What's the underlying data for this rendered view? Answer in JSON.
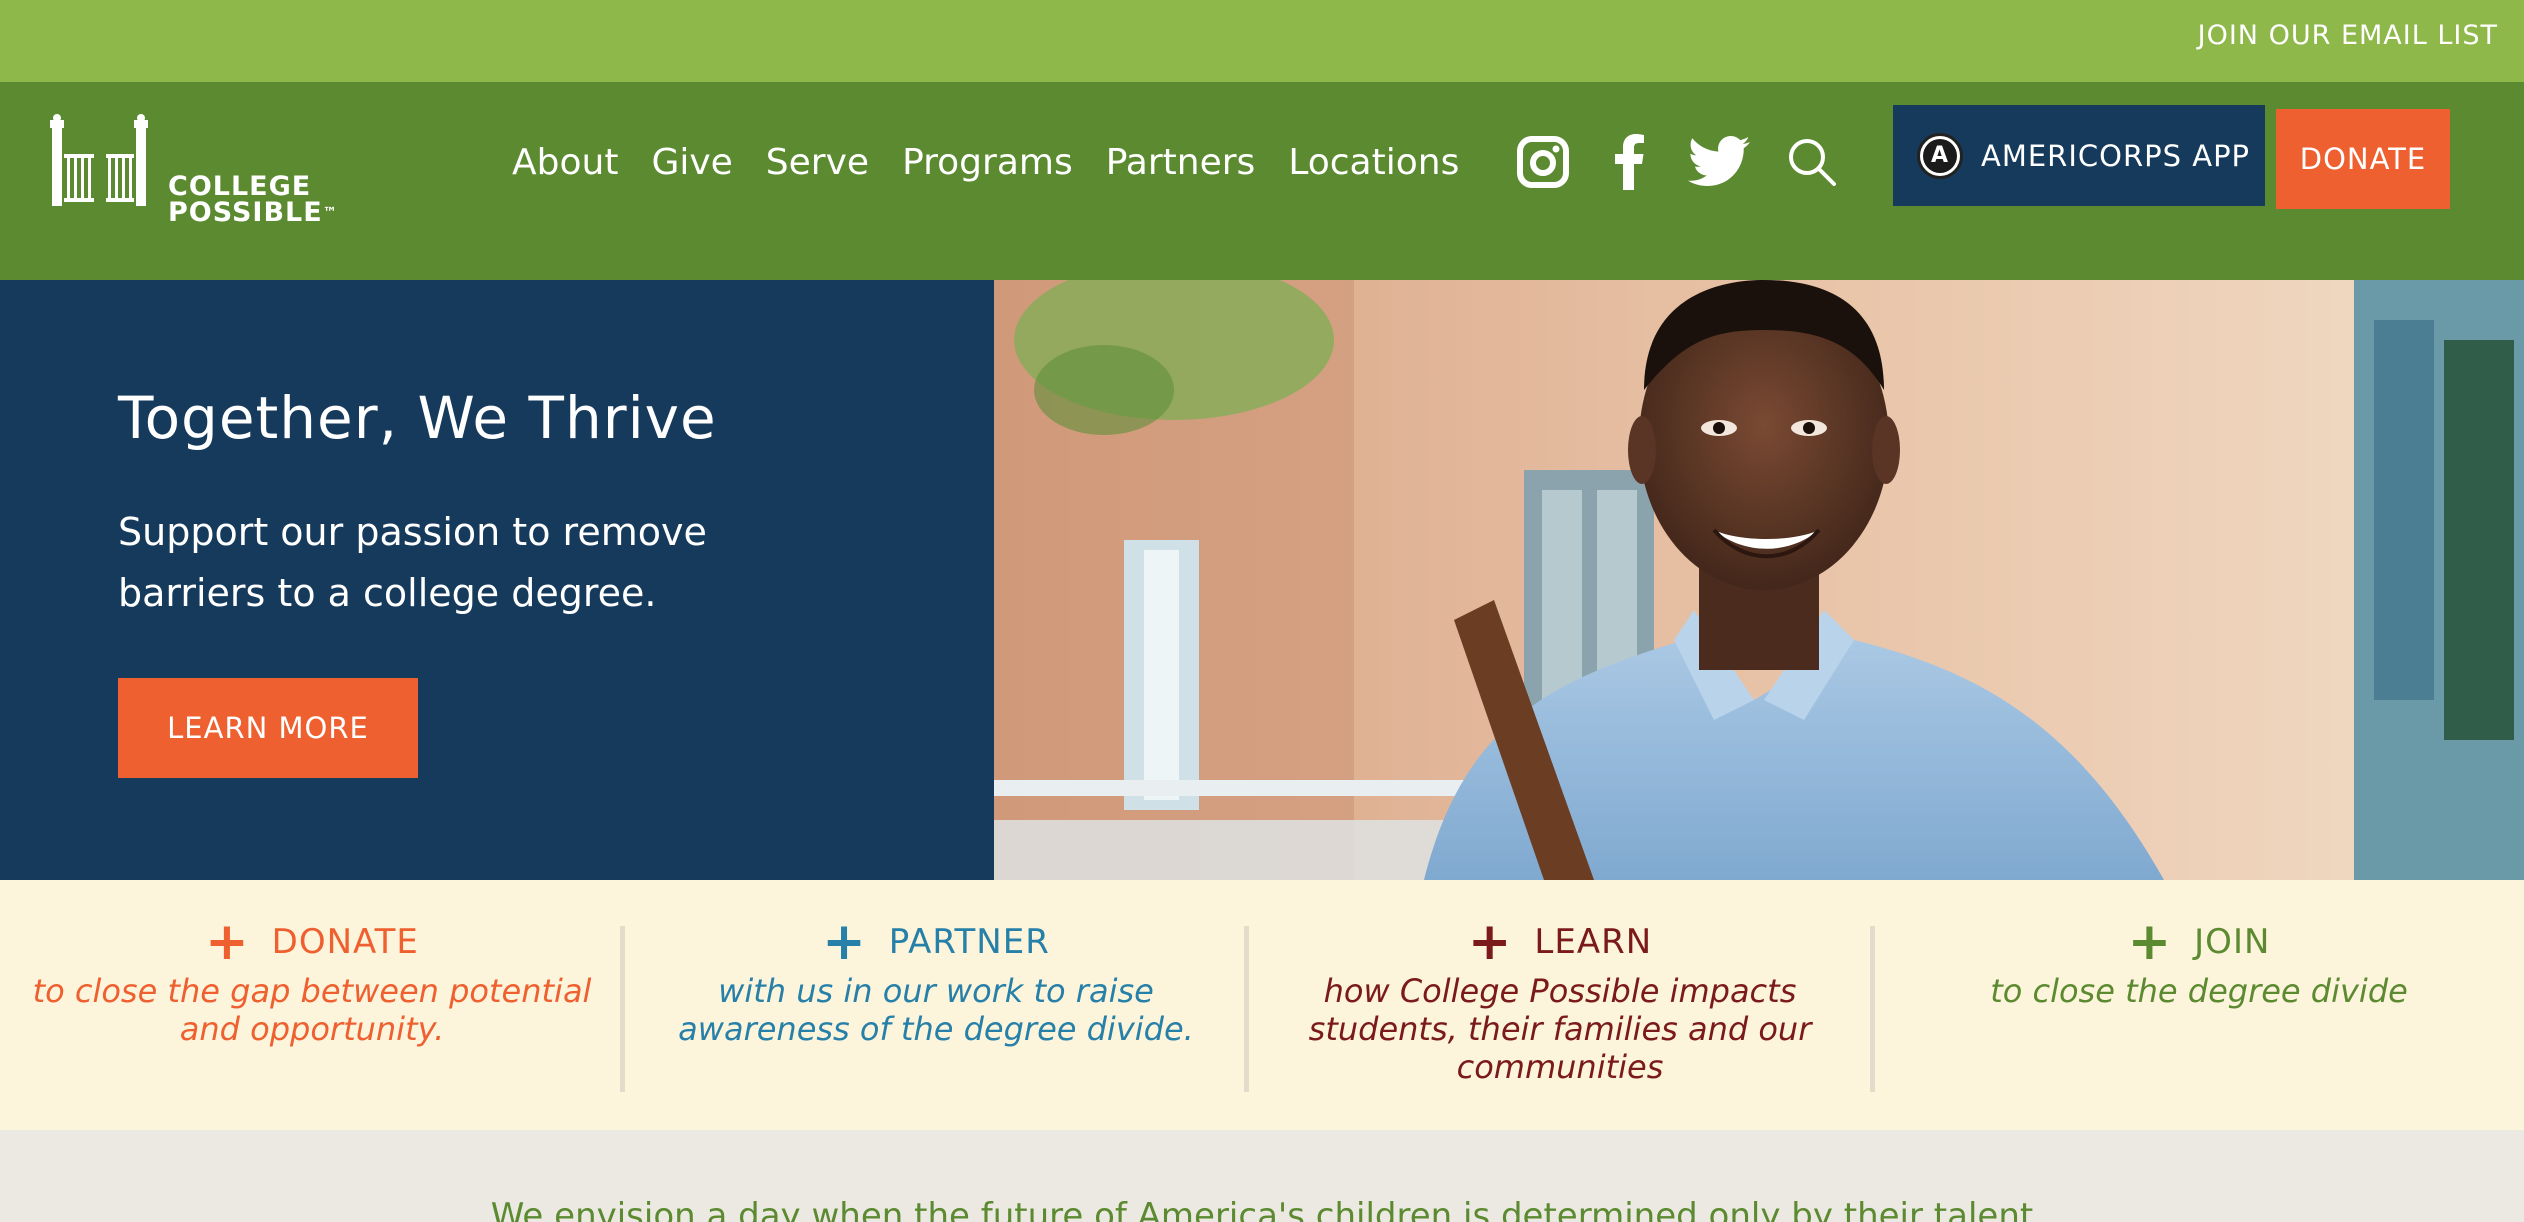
{
  "topbar": {
    "email_link": "JOIN OUR EMAIL LIST"
  },
  "logo": {
    "line1": "COLLEGE",
    "line2": "POSSIBLE",
    "trademark": "™"
  },
  "nav": {
    "items": [
      {
        "label": "About"
      },
      {
        "label": "Give"
      },
      {
        "label": "Serve"
      },
      {
        "label": "Programs"
      },
      {
        "label": "Partners"
      },
      {
        "label": "Locations"
      }
    ],
    "social_icons": [
      "instagram-icon",
      "facebook-icon",
      "twitter-icon",
      "search-icon"
    ],
    "americorps_label": "AMERICORPS APP",
    "americorps_badge": "A",
    "donate_label": "DONATE"
  },
  "hero": {
    "title": "Together, We Thrive",
    "subtitle": "Support our passion to remove barriers to a college degree.",
    "cta_label": "LEARN MORE"
  },
  "actions": [
    {
      "plus": "+",
      "title": "DONATE",
      "desc": "to close the gap between potential and opportunity.",
      "color": "#ef6030"
    },
    {
      "plus": "+",
      "title": "PARTNER",
      "desc": "with us in our work to raise awareness of the degree divide.",
      "color": "#2680a8"
    },
    {
      "plus": "+",
      "title": "LEARN",
      "desc": "how College Possible impacts students, their families and our communities",
      "color": "#7a1a1a"
    },
    {
      "plus": "+",
      "title": "JOIN",
      "desc": "to close the degree divide",
      "color": "#5c8a31"
    }
  ],
  "colors": {
    "topbar": "#8fb84a",
    "nav": "#5c8a31",
    "navy": "#163a5c",
    "orange": "#ef6030",
    "cream": "#fdf4dc"
  },
  "bottom_text": "We envision a day when the future of America's children is determined only by their talent"
}
